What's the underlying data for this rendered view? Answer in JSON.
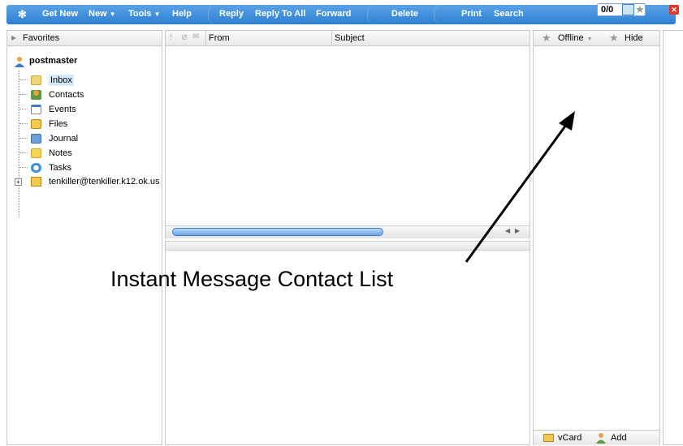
{
  "toolbar": {
    "get_new": "Get New",
    "new": "New",
    "tools": "Tools",
    "help": "Help",
    "reply": "Reply",
    "reply_all": "Reply To All",
    "forward": "Forward",
    "delete": "Delete",
    "print": "Print",
    "search": "Search",
    "counter": "0/0"
  },
  "sidebar": {
    "favorites": "Favorites",
    "account": "postmaster",
    "items": [
      {
        "label": "Inbox",
        "icon": "inbox-icon"
      },
      {
        "label": "Contacts",
        "icon": "contacts-icon"
      },
      {
        "label": "Events",
        "icon": "calendar-icon"
      },
      {
        "label": "Files",
        "icon": "files-icon"
      },
      {
        "label": "Journal",
        "icon": "journal-icon"
      },
      {
        "label": "Notes",
        "icon": "notes-icon"
      },
      {
        "label": "Tasks",
        "icon": "tasks-icon"
      }
    ],
    "extra_account": "tenkiller@tenkiller.k12.ok.us"
  },
  "message_list": {
    "columns": {
      "from": "From",
      "subject": "Subject"
    }
  },
  "im_panel": {
    "status": "Offline",
    "hide": "Hide",
    "vcard": "vCard",
    "add": "Add"
  },
  "annotation": "Instant Message Contact List",
  "colors": {
    "toolbar": "#2d7fd3",
    "selected": "#d6e9fb",
    "accent": "#3a8fe0"
  }
}
